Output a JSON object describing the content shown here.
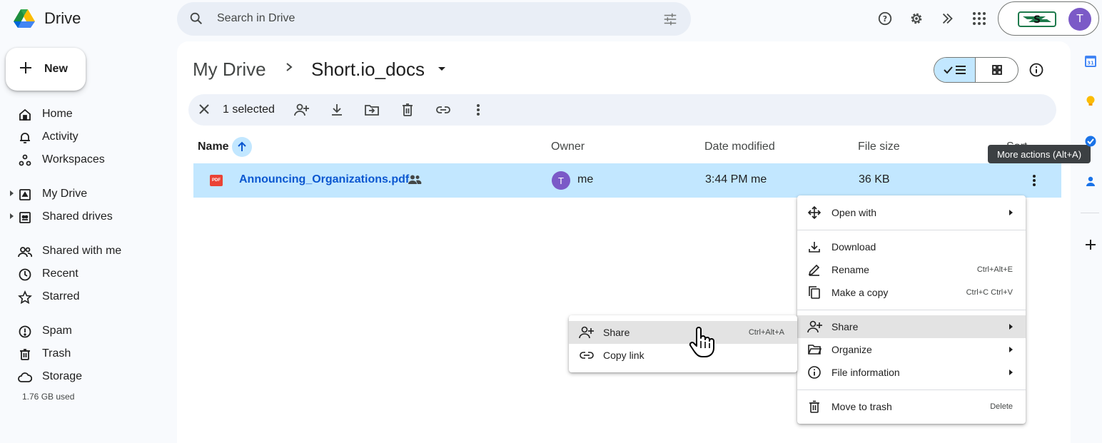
{
  "app": {
    "name": "Drive"
  },
  "search": {
    "placeholder": "Search in Drive"
  },
  "top_icons": [
    "help-icon",
    "settings-icon",
    "gemini-icon",
    "apps-grid-icon"
  ],
  "account": {
    "avatar_letter": "T"
  },
  "sidebar": {
    "new_label": "New",
    "items": [
      {
        "label": "Home",
        "icon": "home-icon"
      },
      {
        "label": "Activity",
        "icon": "bell-icon"
      },
      {
        "label": "Workspaces",
        "icon": "workspaces-icon"
      },
      {
        "label": "My Drive",
        "icon": "my-drive-icon"
      },
      {
        "label": "Shared drives",
        "icon": "shared-drives-icon"
      },
      {
        "label": "Shared with me",
        "icon": "people-icon"
      },
      {
        "label": "Recent",
        "icon": "clock-icon"
      },
      {
        "label": "Starred",
        "icon": "star-icon"
      },
      {
        "label": "Spam",
        "icon": "spam-icon"
      },
      {
        "label": "Trash",
        "icon": "trash-icon"
      },
      {
        "label": "Storage",
        "icon": "cloud-icon"
      }
    ],
    "storage_used": "1.76 GB used"
  },
  "breadcrumb": {
    "root": "My Drive",
    "current": "Short.io_docs"
  },
  "selection": {
    "count_label": "1 selected"
  },
  "columns": {
    "name": "Name",
    "owner": "Owner",
    "date": "Date modified",
    "size": "File size",
    "sort": "Sort"
  },
  "file": {
    "name": "Announcing_Organizations.pdf",
    "type_badge": "PDF",
    "owner_letter": "T",
    "owner": "me",
    "modified": "3:44 PM me",
    "size": "36 KB"
  },
  "tooltip": "More actions (Alt+A)",
  "context_menu": {
    "open_with": "Open with",
    "download": "Download",
    "rename": "Rename",
    "rename_shortcut": "Ctrl+Alt+E",
    "make_copy": "Make a copy",
    "make_copy_shortcut": "Ctrl+C Ctrl+V",
    "share": "Share",
    "organize": "Organize",
    "file_information": "File information",
    "move_to_trash": "Move to trash",
    "move_to_trash_shortcut": "Delete"
  },
  "share_submenu": {
    "share": "Share",
    "share_shortcut": "Ctrl+Alt+A",
    "copy_link": "Copy link"
  },
  "side_panel": {
    "calendar_day": "31"
  },
  "colors": {
    "selected_row": "#c2e7ff",
    "accent": "#0b57d0",
    "avatar": "#7b5ac7"
  }
}
